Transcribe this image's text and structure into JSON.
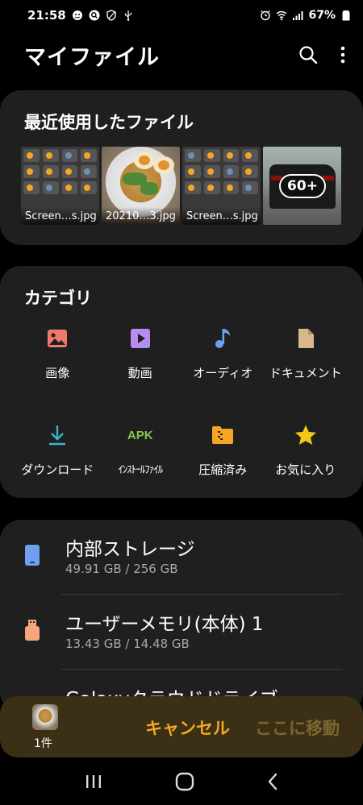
{
  "status": {
    "time": "21:58",
    "battery": "67%"
  },
  "header": {
    "title": "マイファイル"
  },
  "recent": {
    "title": "最近使用したファイル",
    "items": [
      {
        "label": "Screen…s.jpg",
        "kind": "screenshot"
      },
      {
        "label": "20210…3.jpg",
        "kind": "food-photo"
      },
      {
        "label": "Screen…s.jpg",
        "kind": "screenshot"
      },
      {
        "label": "",
        "kind": "car-photo",
        "more": "60+"
      }
    ]
  },
  "categories": {
    "title": "カテゴリ",
    "items": [
      {
        "label": "画像",
        "icon": "image-icon",
        "color": "#f0796b"
      },
      {
        "label": "動画",
        "icon": "video-icon",
        "color": "#b58cf0"
      },
      {
        "label": "オーディオ",
        "icon": "audio-icon",
        "color": "#6f9ff0"
      },
      {
        "label": "ドキュメント",
        "icon": "document-icon",
        "color": "#d9b88b"
      },
      {
        "label": "ダウンロード",
        "icon": "download-icon",
        "color": "#3ab7c7"
      },
      {
        "label": "ｲﾝｽﾄｰﾙﾌｧｲﾙ",
        "icon": "apk-icon",
        "color": "#8bc34a",
        "icon_text": "APK"
      },
      {
        "label": "圧縮済み",
        "icon": "archive-icon",
        "color": "#f5a623"
      },
      {
        "label": "お気に入り",
        "icon": "star-icon",
        "color": "#f5c518"
      }
    ]
  },
  "storage": {
    "items": [
      {
        "name": "内部ストレージ",
        "size": "49.91 GB / 256 GB",
        "color": "#6f9ff0"
      },
      {
        "name": "ユーザーメモリ(本体) 1",
        "size": "13.43 GB / 14.48 GB",
        "color": "#f7a57a"
      },
      {
        "name": "Galaxyクラウドドライブ",
        "size": ""
      }
    ]
  },
  "move_bar": {
    "count": "1件",
    "cancel_label": "キャンセル",
    "move_label": "ここに移動"
  }
}
